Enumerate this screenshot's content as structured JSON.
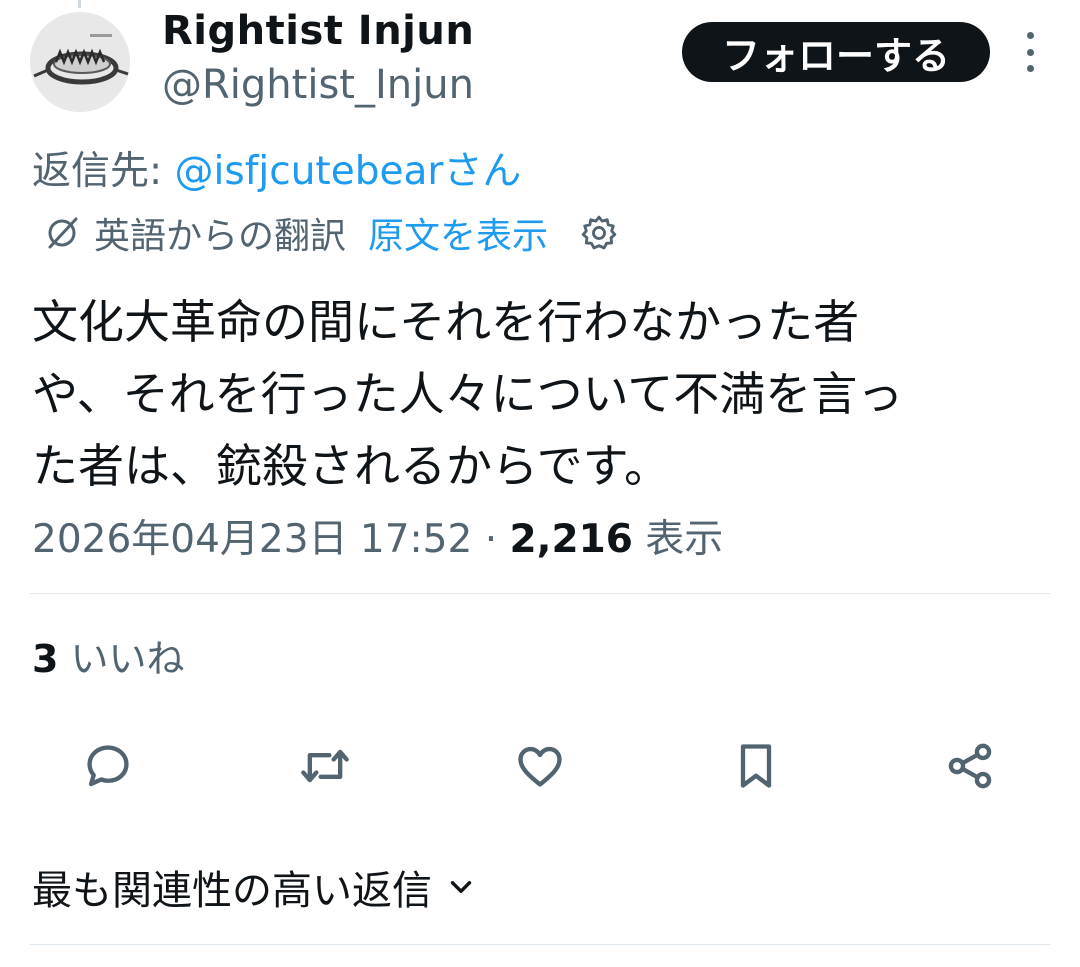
{
  "author": {
    "display_name": "Rightist Injun",
    "handle": "@Rightist_Injun",
    "avatar_icon": "bear-trap-avatar"
  },
  "follow_label": "フォローする",
  "reply_to": {
    "prefix": "返信先: ",
    "mention": "@isfjcutebearさん"
  },
  "translation": {
    "label": "英語からの翻訳",
    "show_original": "原文を表示"
  },
  "tweet": {
    "lines": [
      "文化大革命の間にそれを行わなかった者",
      "や、それを行った人々について不満を言っ",
      "た者は、銃殺されるからです。"
    ]
  },
  "meta": {
    "timestamp": "2026年04月23日 17:52",
    "separator": " · ",
    "views_count": "2,216",
    "views_label": " 表示"
  },
  "likes": {
    "count": "3",
    "label": " いいね"
  },
  "actions": [
    "reply-icon",
    "retweet-icon",
    "like-icon",
    "bookmark-icon",
    "share-icon"
  ],
  "sort": {
    "label": "最も関連性の高い返信"
  },
  "colors": {
    "text": "#0f1419",
    "secondary": "#536471",
    "accent": "#1d9bf0",
    "divider": "#e1e8ed"
  }
}
